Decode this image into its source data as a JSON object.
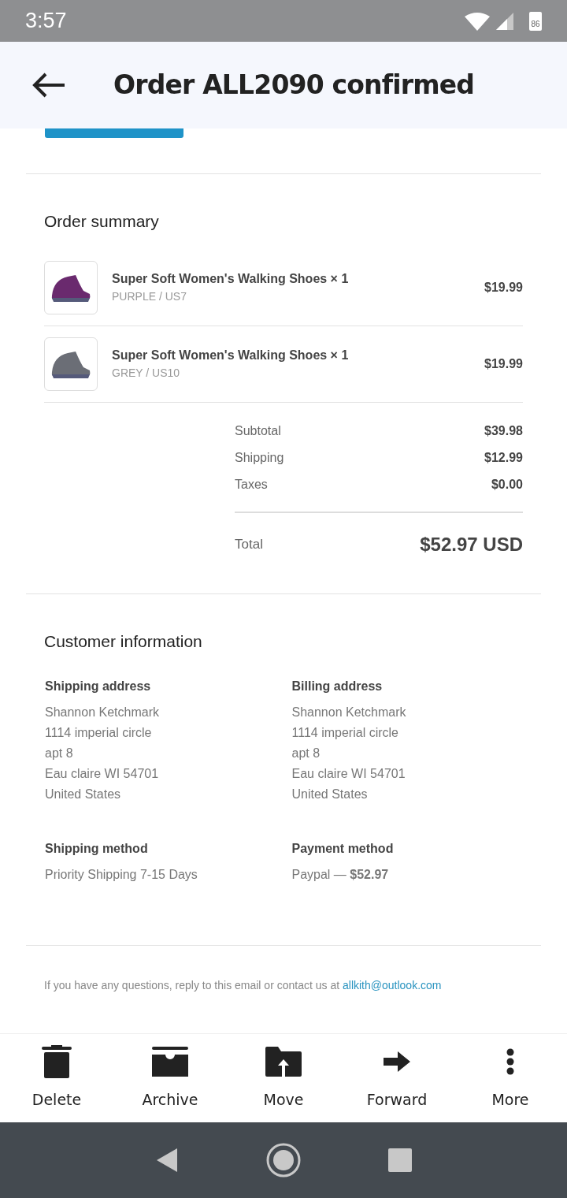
{
  "status_bar": {
    "time": "3:57",
    "battery": "86"
  },
  "header": {
    "title": "Order ALL2090 confirmed"
  },
  "order_summary": {
    "title": "Order summary",
    "items": [
      {
        "name": "Super Soft Women's Walking Shoes × 1",
        "variant": "PURPLE / US7",
        "price": "$19.99",
        "color": "#6a2a6e"
      },
      {
        "name": "Super Soft Women's Walking Shoes × 1",
        "variant": "GREY / US10",
        "price": "$19.99",
        "color": "#6b6e76"
      }
    ],
    "totals": [
      {
        "label": "Subtotal",
        "value": "$39.98"
      },
      {
        "label": "Shipping",
        "value": "$12.99"
      },
      {
        "label": "Taxes",
        "value": "$0.00"
      }
    ],
    "total": {
      "label": "Total",
      "value": "$52.97 USD"
    }
  },
  "customer_information": {
    "title": "Customer information",
    "blocks": [
      {
        "heading": "Shipping address",
        "lines": [
          "Shannon Ketchmark",
          "1114 imperial circle",
          "apt 8",
          "Eau claire WI 54701",
          "United States"
        ]
      },
      {
        "heading": "Billing address",
        "lines": [
          "Shannon Ketchmark",
          "1114 imperial circle",
          "apt 8",
          "Eau claire WI 54701",
          "United States"
        ]
      },
      {
        "heading": "Shipping method",
        "lines": [
          "Priority Shipping 7-15 Days"
        ]
      },
      {
        "heading": "Payment method",
        "lines": [
          "Paypal — **$52.97**"
        ]
      }
    ]
  },
  "footer": {
    "text": "If you have any questions, reply to this email or contact us at",
    "link": "allkith@outlook.com"
  },
  "actions": [
    {
      "kind": "delete",
      "label": "Delete"
    },
    {
      "kind": "archive",
      "label": "Archive"
    },
    {
      "kind": "move",
      "label": "Move"
    },
    {
      "kind": "forward",
      "label": "Forward"
    },
    {
      "kind": "more",
      "label": "More"
    }
  ]
}
